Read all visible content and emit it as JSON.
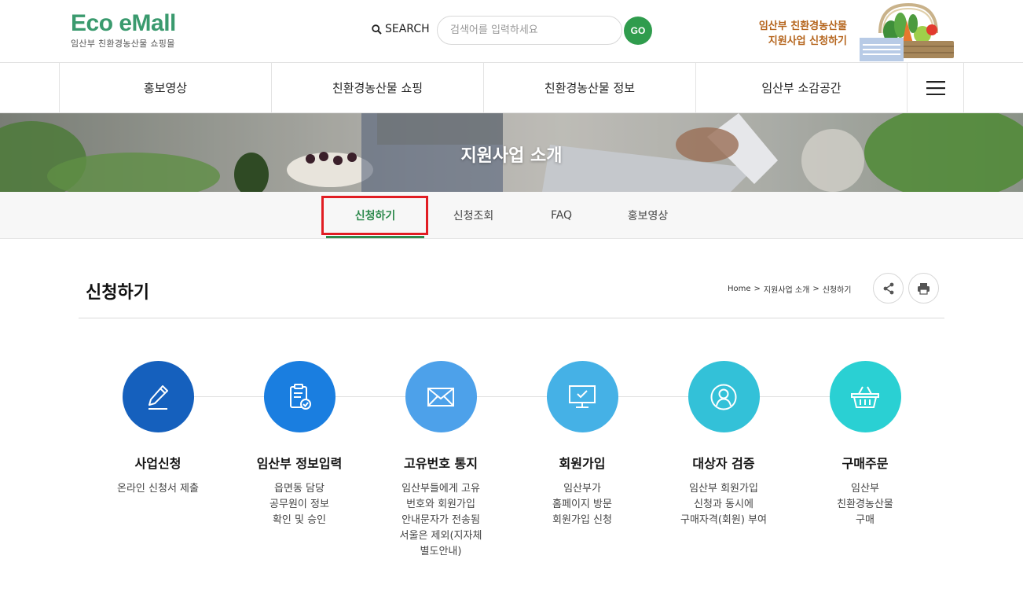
{
  "header": {
    "logo_main": "Eco eMall",
    "logo_sub": "임산부 친환경농산물 쇼핑몰",
    "search_label": "SEARCH",
    "search_placeholder": "검색어를 입력하세요",
    "go_label": "GO",
    "promo_line1": "임산부 친환경농산물",
    "promo_line2": "지원사업 신청하기"
  },
  "nav": {
    "items": [
      {
        "label": "홍보영상"
      },
      {
        "label": "친환경농산물 쇼핑"
      },
      {
        "label": "친환경농산물 정보"
      },
      {
        "label": "임산부 소감공간"
      }
    ]
  },
  "hero": {
    "title": "지원사업 소개"
  },
  "subtabs": [
    {
      "label": "신청하기",
      "active": true
    },
    {
      "label": "신청조회"
    },
    {
      "label": "FAQ"
    },
    {
      "label": "홍보영상"
    }
  ],
  "page": {
    "title": "신청하기",
    "breadcrumb": [
      "Home",
      "지원사업 소개",
      "신청하기"
    ],
    "breadcrumb_sep": ">"
  },
  "steps": [
    {
      "title": "사업신청",
      "desc": "온라인 신청서 제출",
      "icon": "pen-icon",
      "color": "#1560bd"
    },
    {
      "title": "임산부 정보입력",
      "desc": "읍면동 담당\n공무원이 정보\n확인 및 승인",
      "icon": "clipboard-check-icon",
      "color": "#1a7ee0"
    },
    {
      "title": "고유번호 통지",
      "desc": "임산부들에게 고유\n번호와 회원가입\n안내문자가 전송됨\n서울은 제외(지자체\n별도안내)",
      "icon": "envelope-icon",
      "color": "#4da1ea"
    },
    {
      "title": "회원가입",
      "desc": "임산부가\n홈페이지 방문\n회원가입 신청",
      "icon": "monitor-check-icon",
      "color": "#45b1e6"
    },
    {
      "title": "대상자 검증",
      "desc": "임산부 회원가입\n신청과 동시에\n구매자격(회원) 부여",
      "icon": "user-icon",
      "color": "#33c1d8"
    },
    {
      "title": "구매주문",
      "desc": "임산부\n친환경농산물\n구매",
      "icon": "basket-icon",
      "color": "#2ad0d3"
    }
  ],
  "colors": {
    "brand_green": "#3a9a6e",
    "go_green": "#2f9c4d",
    "tab_active": "#2f8a4e",
    "promo": "#b5651d",
    "highlight": "#e11d23"
  }
}
